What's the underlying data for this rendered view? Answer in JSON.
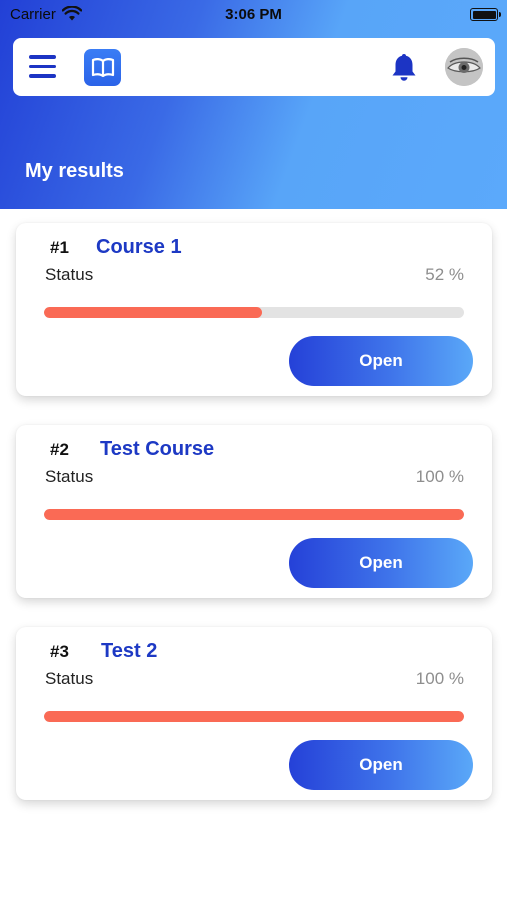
{
  "status_bar": {
    "carrier": "Carrier",
    "time": "3:06 PM",
    "wifi_icon": "wifi-icon",
    "battery_icon": "battery-icon"
  },
  "topbar": {
    "menu_icon": "hamburger-menu-icon",
    "logo_icon": "open-book-icon",
    "notification_icon": "bell-icon",
    "avatar": "user-avatar",
    "accent_color": "#1c34c4"
  },
  "page": {
    "title": "My results"
  },
  "results": [
    {
      "rank": "#1",
      "name": "Course 1",
      "status_label": "Status",
      "percent_text": "52 %",
      "progress": 0.52,
      "button_label": "Open"
    },
    {
      "rank": "#2",
      "name": "Test Course",
      "status_label": "Status",
      "percent_text": "100 %",
      "progress": 1.0,
      "button_label": "Open"
    },
    {
      "rank": "#3",
      "name": "Test 2",
      "status_label": "Status",
      "percent_text": "100 %",
      "progress": 1.0,
      "button_label": "Open"
    }
  ],
  "colors": {
    "brand_blue": "#1d39c4",
    "progress_fill": "#fa6a55",
    "progress_track": "#e3e3e3",
    "header_gradient_start": "#2240d6",
    "header_gradient_end": "#5ba9fb"
  }
}
